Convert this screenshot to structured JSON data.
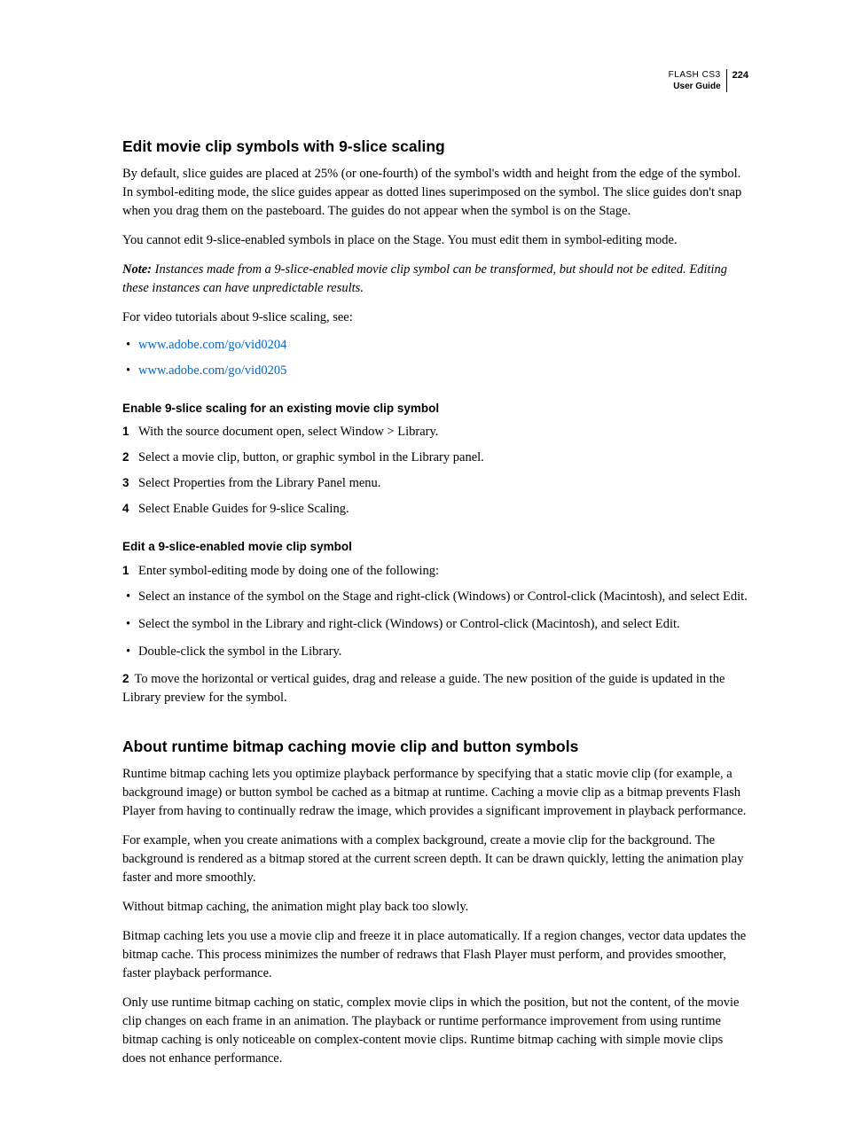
{
  "header": {
    "product": "FLASH CS3",
    "sub": "User Guide",
    "page": "224"
  },
  "s1": {
    "title": "Edit movie clip symbols with 9-slice scaling",
    "p1": "By default, slice guides are placed at 25% (or one-fourth) of the symbol's width and height from the edge of the symbol. In symbol-editing mode, the slice guides appear as dotted lines superimposed on the symbol. The slice guides don't snap when you drag them on the pasteboard. The guides do not appear when the symbol is on the Stage.",
    "p2": "You cannot edit 9-slice-enabled symbols in place on the Stage. You must edit them in symbol-editing mode.",
    "note_label": "Note:",
    "note": " Instances made from a 9-slice-enabled movie clip symbol can be transformed, but should not be edited. Editing these instances can have unpredictable results.",
    "p3": "For video tutorials about 9-slice scaling, see:",
    "link1": "www.adobe.com/go/vid0204",
    "link2": "www.adobe.com/go/vid0205"
  },
  "s1a": {
    "title": "Enable 9-slice scaling for an existing movie clip symbol",
    "n1": "1",
    "t1": "With the source document open, select Window > Library.",
    "n2": "2",
    "t2": "Select a movie clip, button, or graphic symbol in the Library panel.",
    "n3": "3",
    "t3": "Select Properties from the Library Panel menu.",
    "n4": "4",
    "t4": "Select Enable Guides for 9-slice Scaling."
  },
  "s1b": {
    "title": "Edit a 9-slice-enabled movie clip symbol",
    "n1": "1",
    "t1": "Enter symbol-editing mode by doing one of the following:",
    "b1": "Select an instance of the symbol on the Stage and right-click (Windows) or Control-click (Macintosh), and select Edit.",
    "b2": "Select the symbol in the Library and right-click (Windows) or Control-click (Macintosh), and select Edit.",
    "b3": "Double-click the symbol in the Library.",
    "n2": "2",
    "t2": "To move the horizontal or vertical guides, drag and release a guide. The new position of the guide is updated in the Library preview for the symbol."
  },
  "s2": {
    "title": "About runtime bitmap caching movie clip and button symbols",
    "p1": "Runtime bitmap caching lets you optimize playback performance by specifying that a static movie clip (for example, a background image) or button symbol be cached as a bitmap at runtime. Caching a movie clip as a bitmap prevents Flash Player from having to continually redraw the image, which provides a significant improvement in playback performance.",
    "p2": "For example, when you create animations with a complex background, create a movie clip for the background. The background is rendered as a bitmap stored at the current screen depth. It can be drawn quickly, letting the animation play faster and more smoothly.",
    "p3": "Without bitmap caching, the animation might play back too slowly.",
    "p4": "Bitmap caching lets you use a movie clip and freeze it in place automatically. If a region changes, vector data updates the bitmap cache. This process minimizes the number of redraws that Flash Player must perform, and provides smoother, faster playback performance.",
    "p5": "Only use runtime bitmap caching on static, complex movie clips in which the position, but not the content, of the movie clip changes on each frame in an animation. The playback or runtime performance improvement from using runtime bitmap caching is only noticeable on complex-content movie clips. Runtime bitmap caching with simple movie clips does not enhance performance."
  }
}
